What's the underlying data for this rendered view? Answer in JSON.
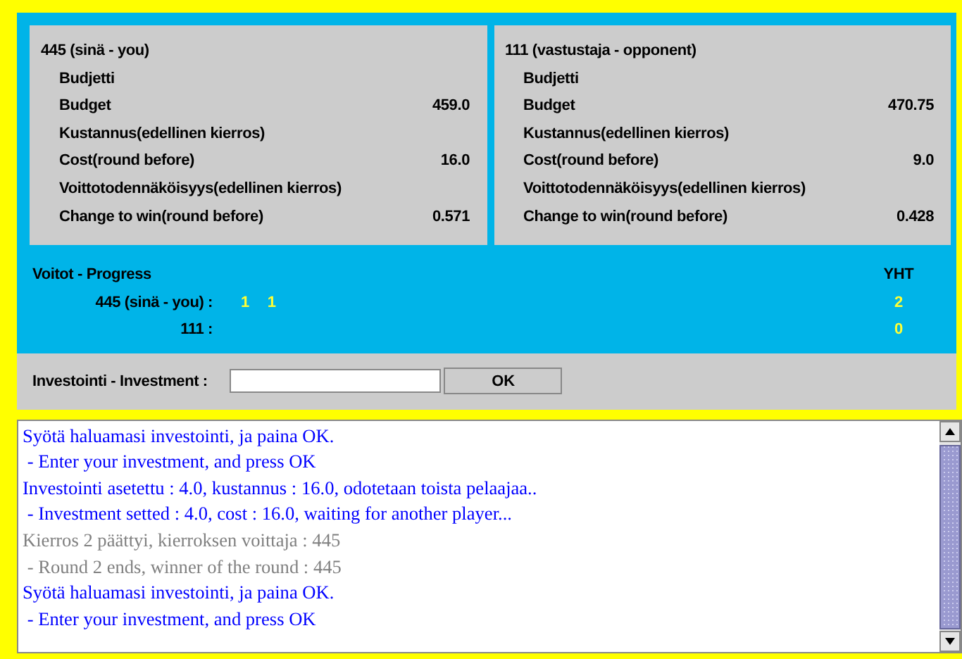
{
  "players": [
    {
      "title": "445 (sinä - you)",
      "rows": [
        {
          "label": "Budjetti"
        },
        {
          "label": "Budget",
          "value": "459.0"
        },
        {
          "label": "Kustannus(edellinen kierros)"
        },
        {
          "label": "Cost(round before)",
          "value": "16.0"
        },
        {
          "label": "Voittotodennäköisyys(edellinen kierros)"
        },
        {
          "label": "Change to win(round before)",
          "value": "0.571"
        }
      ]
    },
    {
      "title": "111 (vastustaja - opponent)",
      "rows": [
        {
          "label": "Budjetti"
        },
        {
          "label": "Budget",
          "value": "470.75"
        },
        {
          "label": "Kustannus(edellinen kierros)"
        },
        {
          "label": "Cost(round before)",
          "value": "9.0"
        },
        {
          "label": "Voittotodennäköisyys(edellinen kierros)"
        },
        {
          "label": "Change to win(round before)",
          "value": "0.428"
        }
      ]
    }
  ],
  "progress": {
    "title": "Voitot - Progress",
    "total_header": "YHT",
    "rows": [
      {
        "name": "445 (sinä - you) :",
        "wins": [
          "1",
          "1"
        ],
        "total": "2"
      },
      {
        "name": "111 :",
        "wins": [],
        "total": "0"
      }
    ]
  },
  "investment": {
    "label": "Investointi - Investment :",
    "button": "OK"
  },
  "log": [
    {
      "text": "Syötä haluamasi investointi, ja paina OK.",
      "color": "#0000ff"
    },
    {
      "text": " - Enter your investment, and press OK",
      "color": "#0000ff"
    },
    {
      "text": "Investointi asetettu : 4.0, kustannus : 16.0, odotetaan toista pelaajaa..",
      "color": "#0000ff"
    },
    {
      "text": " - Investment setted : 4.0, cost : 16.0, waiting for another player...",
      "color": "#0000ff"
    },
    {
      "text": "Kierros 2 päättyi, kierroksen voittaja : 445",
      "color": "#808080"
    },
    {
      "text": " - Round 2 ends, winner of the round : 445",
      "color": "#808080"
    },
    {
      "text": "Syötä haluamasi investointi, ja paina OK.",
      "color": "#0000ff"
    },
    {
      "text": " - Enter your investment, and press OK",
      "color": "#0000ff"
    }
  ]
}
